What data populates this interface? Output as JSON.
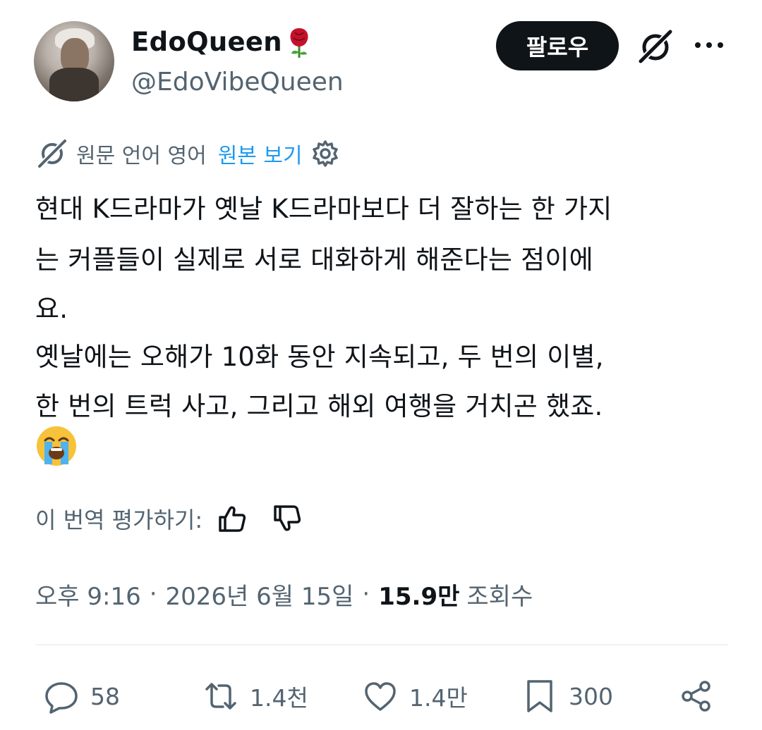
{
  "user": {
    "display_name": "EdoQueen",
    "handle": "@EdoVibeQueen",
    "name_emoji": "rose-icon"
  },
  "header": {
    "follow_label": "팔로우"
  },
  "translation": {
    "source_label": "원문 언어 영어",
    "show_original": "원본 보기"
  },
  "post": {
    "lines": [
      "현대 K드라마가 옛날 K드라마보다 더 잘하는 한 가지",
      "는 커플들이 실제로 서로 대화하게 해준다는 점이에",
      "요.",
      "옛날에는 오해가 10화 동안 지속되고, 두 번의 이별,",
      "한 번의 트럭 사고, 그리고 해외 여행을 거치곤 했죠."
    ],
    "emoji": "loudly-crying-face"
  },
  "rating": {
    "label": "이 번역 평가하기:"
  },
  "meta": {
    "time": "오후 9:16",
    "date": "2026년 6월 15일",
    "separator": "·",
    "views_count": "15.9만",
    "views_label": "조회수"
  },
  "actions": {
    "replies": "58",
    "reposts": "1.4천",
    "likes": "1.4만",
    "bookmarks": "300"
  },
  "colors": {
    "text": "#0f1419",
    "secondary": "#536471",
    "accent": "#1d9bf0",
    "button_bg": "#0f1419",
    "divider": "#eff3f4"
  }
}
